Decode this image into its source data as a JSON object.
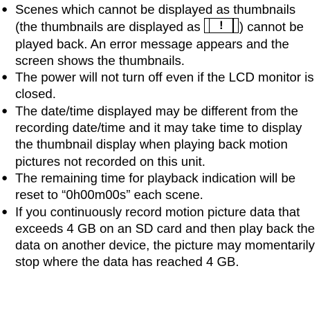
{
  "notes": [
    {
      "before": "Scenes which cannot be displayed as thumbnails (the thumbnails are displayed as ",
      "icon": "warning-thumbnail-icon",
      "icon_glyph": "!",
      "after": ") cannot be played back. An error message appears and the screen shows the thumbnails."
    },
    {
      "text": "The power will not turn off even if the LCD monitor is closed."
    },
    {
      "text": "The date/time displayed may be different from the recording date/time and it may take time to display the thumbnail display when playing back motion pictures not recorded on this unit."
    },
    {
      "text": "The remaining time for playback indication will be reset to “0h00m00s” each scene."
    },
    {
      "text": "If you continuously record motion picture data that exceeds 4 GB on an SD card and then play back the data on another device, the picture may momentarily stop where the data has reached 4 GB."
    }
  ],
  "bullet": "●"
}
